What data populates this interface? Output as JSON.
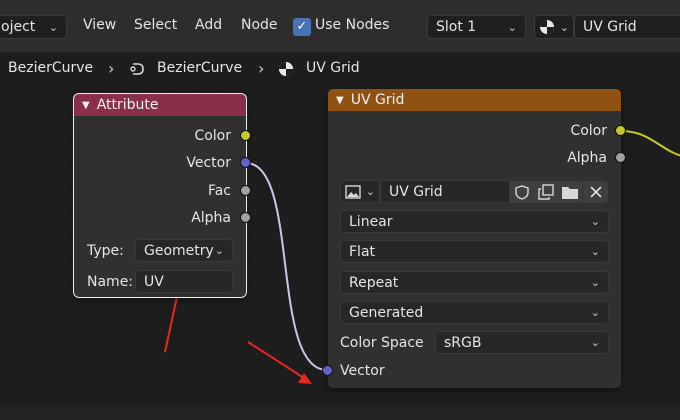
{
  "header": {
    "object_menu": "oject",
    "menu": [
      "View",
      "Select",
      "Add",
      "Node"
    ],
    "use_nodes_label": "Use Nodes",
    "use_nodes_checked": true,
    "slot": "Slot 1",
    "image_name": "UV Grid"
  },
  "breadcrumb": [
    "BezierCurve",
    "BezierCurve",
    "UV Grid"
  ],
  "attribute_node": {
    "title": "Attribute",
    "outputs": [
      "Color",
      "Vector",
      "Fac",
      "Alpha"
    ],
    "type_label": "Type:",
    "type_value": "Geometry",
    "name_label": "Name:",
    "name_value": "UV"
  },
  "image_node": {
    "title": "UV Grid",
    "outputs": [
      "Color",
      "Alpha"
    ],
    "image_name": "UV Grid",
    "interpolation": "Linear",
    "projection": "Flat",
    "extension": "Repeat",
    "source": "Generated",
    "color_space_label": "Color Space",
    "color_space_value": "sRGB",
    "input_vector": "Vector"
  },
  "colors": {
    "attribute_header": "#8a2f48",
    "image_header": "#8f5212",
    "color_socket": "#c7c729",
    "vector_socket": "#6363c7",
    "gray_socket": "#a1a1a1",
    "annotation": "#e6291e"
  },
  "icons": [
    "dropdown-chevron",
    "breadcrumb-arrow",
    "node-link-icon",
    "checker-sphere-icon",
    "image-icon",
    "shield-icon",
    "duplicate-icon",
    "folder-icon",
    "close-icon"
  ]
}
